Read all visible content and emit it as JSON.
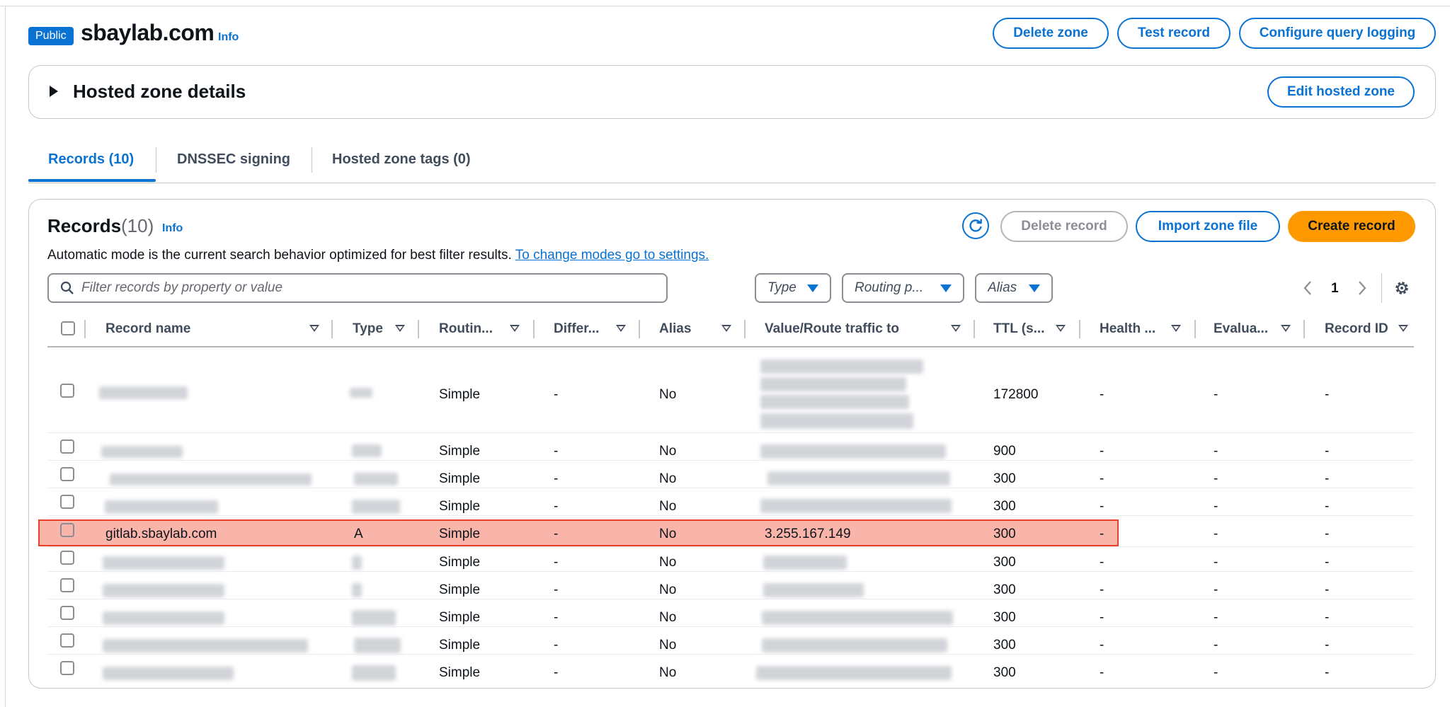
{
  "zone": {
    "badge": "Public",
    "name": "sbaylab.com",
    "info": "Info",
    "actions": {
      "delete": "Delete zone",
      "test": "Test record",
      "logging": "Configure query logging"
    }
  },
  "details": {
    "title": "Hosted zone details",
    "edit": "Edit hosted zone"
  },
  "tabs": [
    "Records (10)",
    "DNSSEC signing",
    "Hosted zone tags (0)"
  ],
  "records_panel": {
    "title": "Records",
    "count": "(10)",
    "info": "Info",
    "note": "Automatic mode is the current search behavior optimized for best filter results.",
    "note_link": "To change modes go to settings.",
    "buttons": {
      "delete": "Delete record",
      "import": "Import zone file",
      "create": "Create record"
    },
    "search_placeholder": "Filter records by property or value",
    "filters": {
      "type": "Type",
      "routing": "Routing p...",
      "alias": "Alias"
    },
    "page": "1"
  },
  "columns": [
    "Record name",
    "Type",
    "Routin...",
    "Differ...",
    "Alias",
    "Value/Route traffic to",
    "TTL (s...",
    "Health ...",
    "Evalua...",
    "Record ID"
  ],
  "rows": [
    {
      "name": "",
      "type": "",
      "routing": "Simple",
      "differ": "-",
      "alias": "No",
      "value": "",
      "ttl": "172800",
      "health": "-",
      "eval": "-",
      "id": "-"
    },
    {
      "name": "",
      "type": "",
      "routing": "Simple",
      "differ": "-",
      "alias": "No",
      "value": "",
      "ttl": "900",
      "health": "-",
      "eval": "-",
      "id": "-"
    },
    {
      "name": "",
      "type": "",
      "routing": "Simple",
      "differ": "-",
      "alias": "No",
      "value": "",
      "ttl": "300",
      "health": "-",
      "eval": "-",
      "id": "-"
    },
    {
      "name": "",
      "type": "",
      "routing": "Simple",
      "differ": "-",
      "alias": "No",
      "value": "",
      "ttl": "300",
      "health": "-",
      "eval": "-",
      "id": "-"
    },
    {
      "name": "gitlab.sbaylab.com",
      "type": "A",
      "routing": "Simple",
      "differ": "-",
      "alias": "No",
      "value": "3.255.167.149",
      "ttl": "300",
      "health": "-",
      "eval": "-",
      "id": "-"
    },
    {
      "name": "",
      "type": "",
      "routing": "Simple",
      "differ": "-",
      "alias": "No",
      "value": "",
      "ttl": "300",
      "health": "-",
      "eval": "-",
      "id": "-"
    },
    {
      "name": "",
      "type": "",
      "routing": "Simple",
      "differ": "-",
      "alias": "No",
      "value": "",
      "ttl": "300",
      "health": "-",
      "eval": "-",
      "id": "-"
    },
    {
      "name": "",
      "type": "",
      "routing": "Simple",
      "differ": "-",
      "alias": "No",
      "value": "",
      "ttl": "300",
      "health": "-",
      "eval": "-",
      "id": "-"
    },
    {
      "name": "",
      "type": "",
      "routing": "Simple",
      "differ": "-",
      "alias": "No",
      "value": "",
      "ttl": "300",
      "health": "-",
      "eval": "-",
      "id": "-"
    },
    {
      "name": "",
      "type": "",
      "routing": "Simple",
      "differ": "-",
      "alias": "No",
      "value": "",
      "ttl": "300",
      "health": "-",
      "eval": "-",
      "id": "-"
    }
  ],
  "colors": {
    "accent": "#0972d3",
    "primary": "#ff9900",
    "highlight": "#f47864"
  }
}
